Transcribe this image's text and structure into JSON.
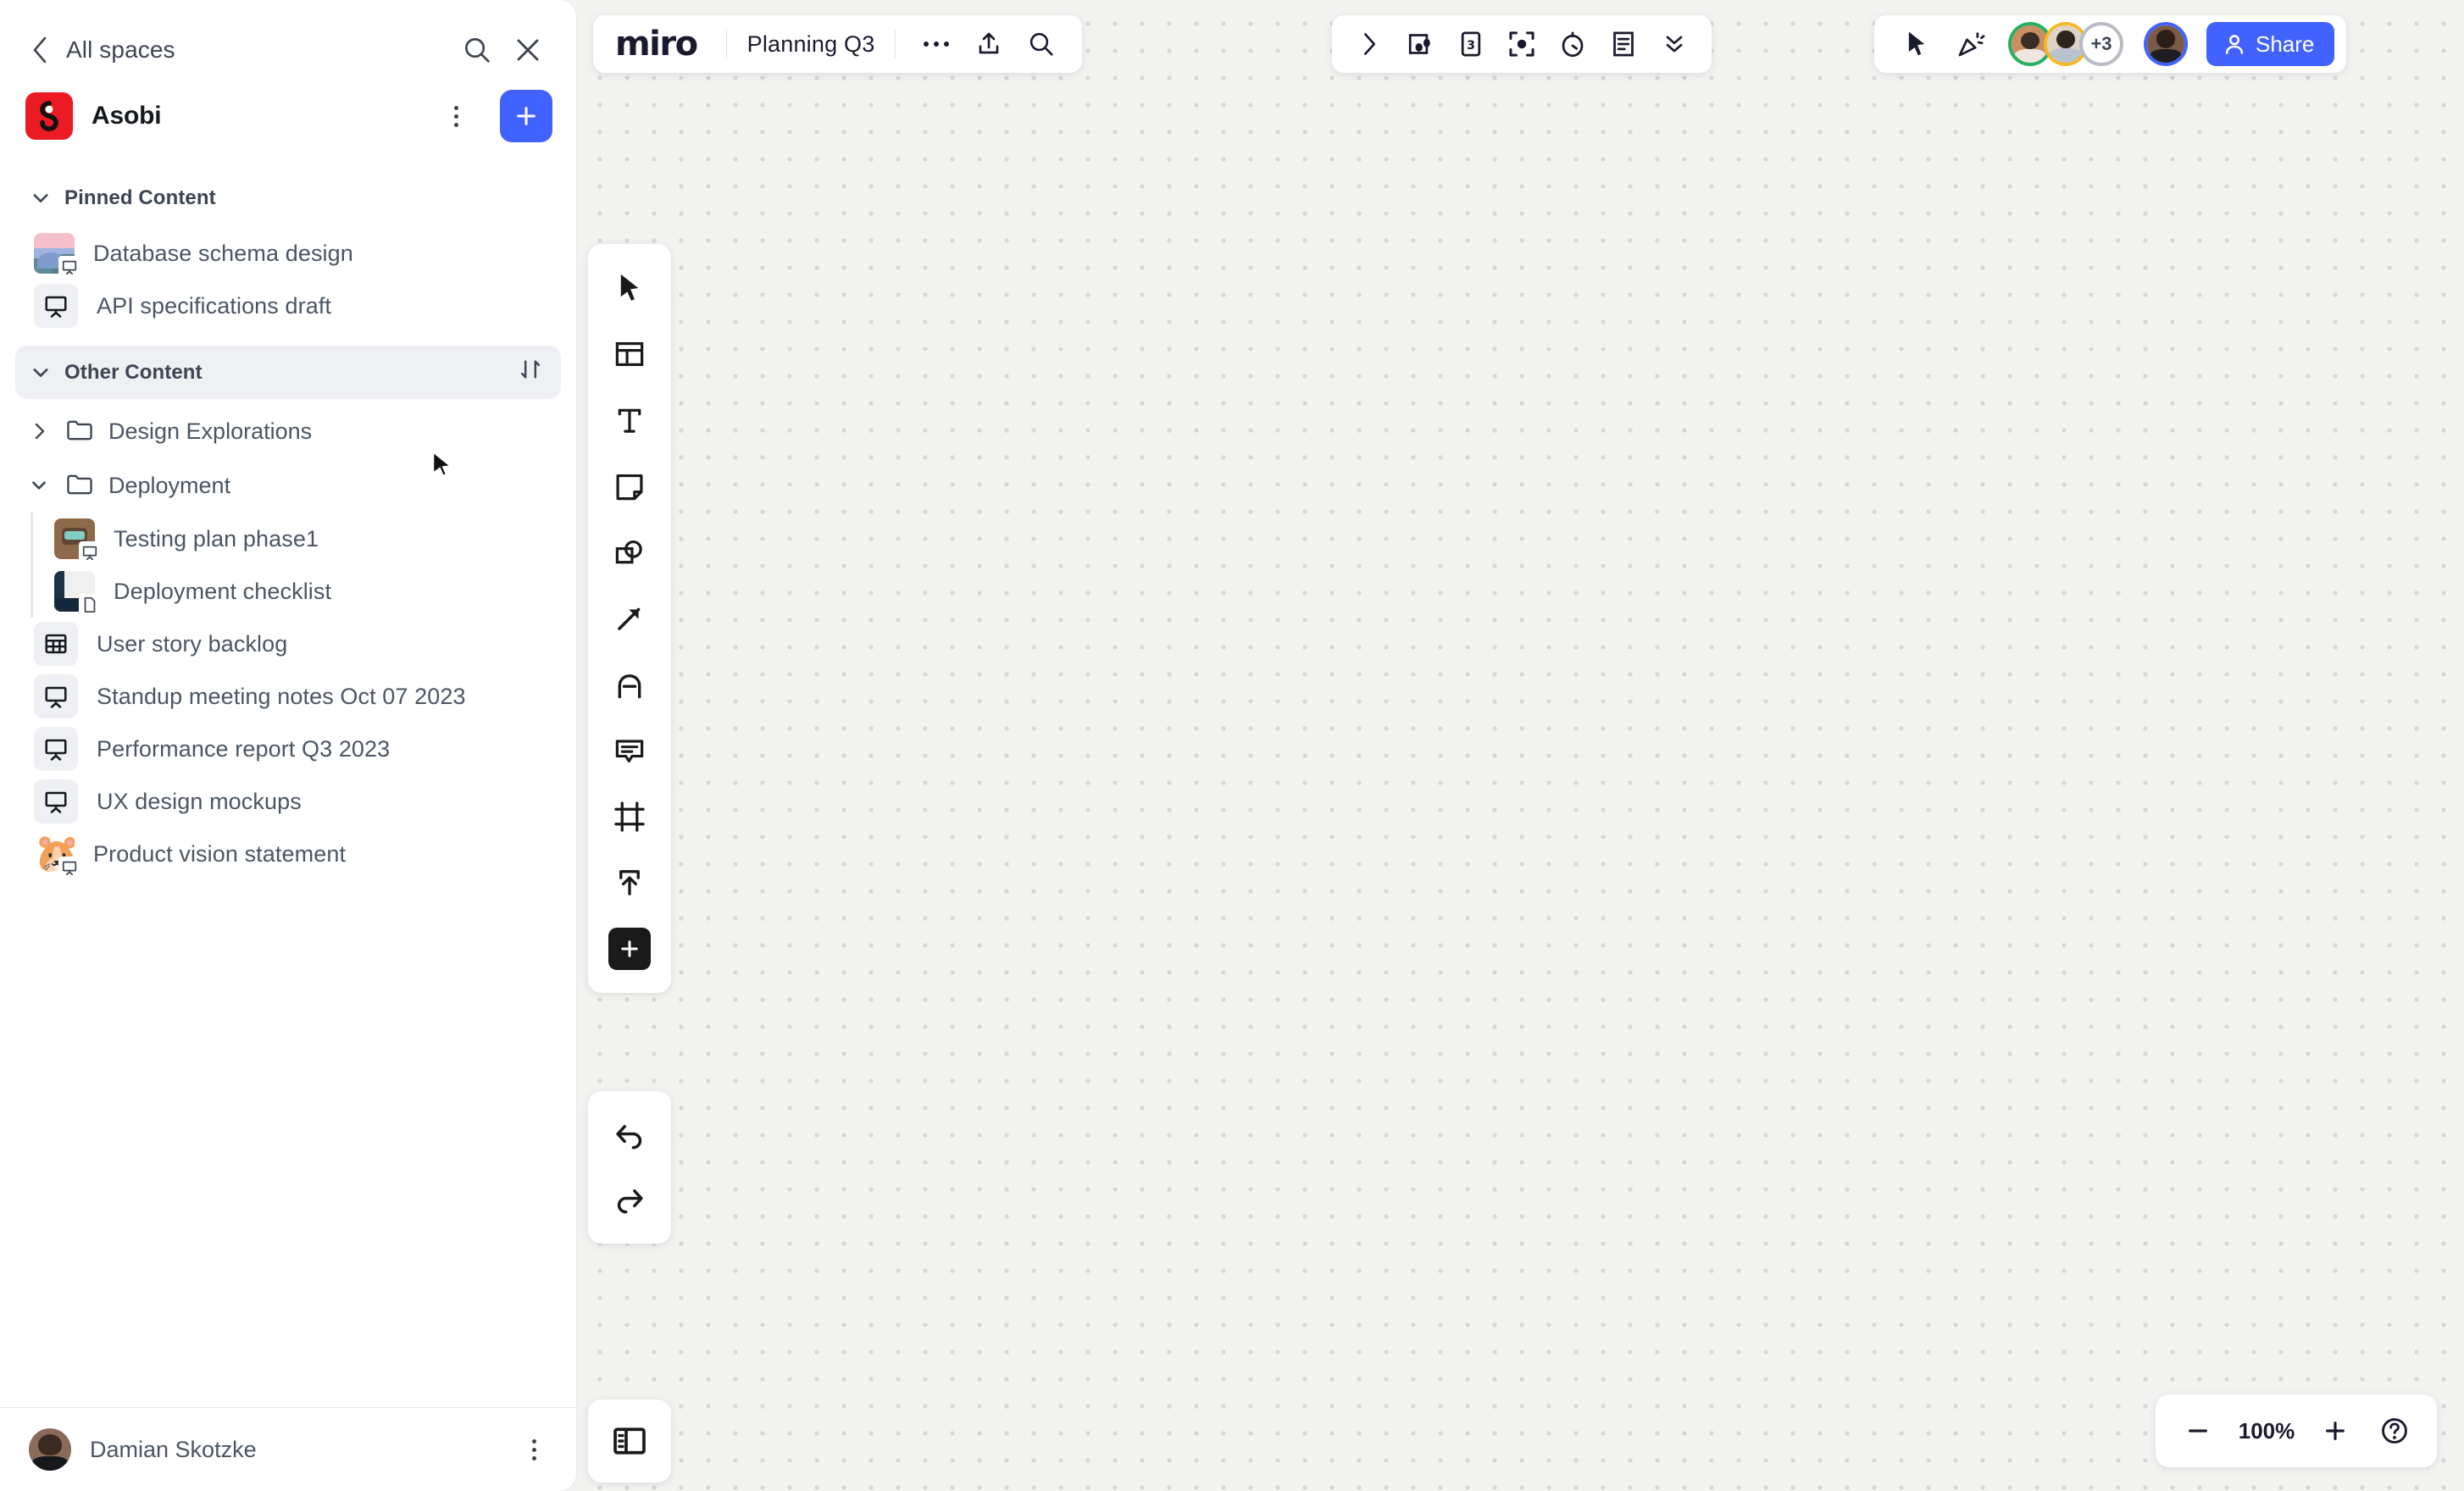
{
  "sidebar": {
    "back_label": "All spaces",
    "search_icon": "search-icon",
    "close_icon": "close-icon",
    "space": {
      "name": "Asobi",
      "logo_color": "#ec1b23",
      "menu_icon": "kebab-menu-icon",
      "add_label": "+"
    },
    "sections": [
      {
        "id": "pinned",
        "label": "Pinned Content",
        "expanded": true,
        "hovered": false
      },
      {
        "id": "other",
        "label": "Other Content",
        "expanded": true,
        "hovered": true,
        "sort_icon": "sort-arrows-icon"
      }
    ],
    "pinned_items": [
      {
        "label": "Database schema design",
        "icon": "board-thumbnail",
        "art": "art-db",
        "badge": "board-badge-icon"
      },
      {
        "label": "API specifications draft",
        "icon": "board-icon",
        "tile": true
      }
    ],
    "folders": [
      {
        "label": "Design Explorations",
        "expanded": false,
        "icon": "folder-icon",
        "children": []
      },
      {
        "label": "Deployment",
        "expanded": true,
        "icon": "folder-icon",
        "children": [
          {
            "label": "Testing plan phase1",
            "art": "art-robot",
            "badge": "board-badge-icon"
          },
          {
            "label": "Deployment checklist",
            "art": "art-deploy",
            "badge": "document-badge-icon"
          }
        ]
      }
    ],
    "other_items": [
      {
        "label": "User story backlog",
        "icon": "table-icon",
        "tile": true
      },
      {
        "label": "Standup meeting notes Oct 07 2023",
        "icon": "board-icon",
        "tile": true
      },
      {
        "label": "Performance report Q3 2023",
        "icon": "board-icon",
        "tile": true
      },
      {
        "label": "UX design mockups",
        "icon": "board-icon",
        "tile": true
      },
      {
        "label": "Product vision statement",
        "art": "art-hamster",
        "emoji": "🐹",
        "badge": "board-badge-icon"
      }
    ],
    "footer": {
      "user_name": "Damian Skotzke",
      "menu_icon": "kebab-menu-icon"
    }
  },
  "topbar": {
    "logo_text": "miro",
    "board_title": "Planning Q3",
    "more_icon": "more-options-icon",
    "upload_icon": "upload-icon",
    "search_icon": "search-icon"
  },
  "collab_toolbar": {
    "icons": [
      "chevron-right-icon",
      "frames-panel-icon",
      "estimation-card-icon",
      "focus-mode-icon",
      "timer-icon",
      "notes-icon",
      "chevron-double-down-icon"
    ]
  },
  "presence": {
    "cursor_icon": "cursor-icon",
    "reaction_icon": "celebration-icon",
    "collaborators": [
      {
        "ring_color": "#27ae60",
        "art": "art-w1"
      },
      {
        "ring_color": "#f5b826",
        "art": "art-w2"
      }
    ],
    "overflow_label": "+3",
    "overflow_ring_color": "#b7bcc4",
    "self": {
      "ring_color": "#4262ff",
      "art": "art-w3"
    },
    "share_label": "Share",
    "share_icon": "person-icon",
    "share_color": "#4262ff"
  },
  "tools": {
    "items": [
      "cursor-select-icon",
      "templates-icon",
      "text-icon",
      "sticky-note-icon",
      "shapes-icon",
      "connector-arrow-icon",
      "pen-draw-icon",
      "comment-icon",
      "frame-icon",
      "upload-icon",
      "more-apps-icon"
    ],
    "undo_icon": "undo-icon",
    "redo_icon": "redo-icon",
    "panel_toggle_icon": "toggle-panel-icon"
  },
  "zoom": {
    "minus_icon": "minus-icon",
    "value": "100%",
    "plus_icon": "plus-icon",
    "help_icon": "help-question-icon"
  }
}
